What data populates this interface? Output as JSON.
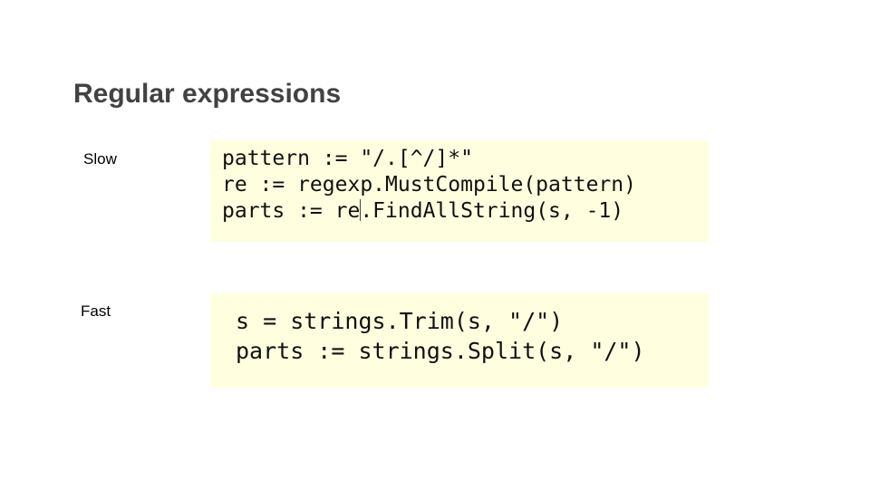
{
  "slide": {
    "title": "Regular expressions"
  },
  "slow": {
    "label": "Slow",
    "lines": [
      "pattern := \"/.[^/]*\"",
      "re := regexp.MustCompile(pattern)"
    ],
    "line3_before_cursor": "parts := re",
    "line3_after_cursor": ".FindAllString(s, -1)"
  },
  "fast": {
    "label": "Fast",
    "lines": [
      "s = strings.Trim(s, \"/\")",
      "parts := strings.Split(s, \"/\")"
    ]
  },
  "colors": {
    "title": "#424242",
    "code_background": "#ffffe0"
  }
}
